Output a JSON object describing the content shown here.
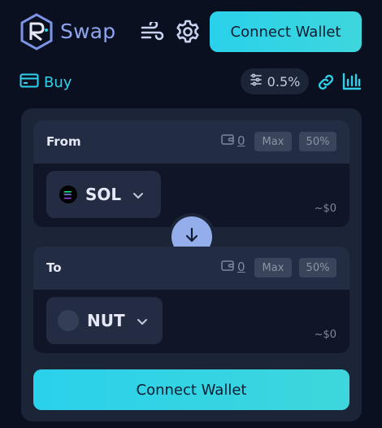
{
  "header": {
    "brand": "Swap",
    "connect_wallet": "Connect Wallet",
    "icons": [
      "logo-icon",
      "wind-icon",
      "gear-icon"
    ]
  },
  "subheader": {
    "buy_label": "Buy",
    "slippage": "0.5%",
    "icons": [
      "card-icon",
      "sliders-icon",
      "link-icon",
      "chart-icon"
    ]
  },
  "from": {
    "label": "From",
    "balance": "0",
    "max_label": "Max",
    "half_label": "50%",
    "token": "SOL",
    "usd_value": "~$0"
  },
  "to": {
    "label": "To",
    "balance": "0",
    "max_label": "Max",
    "half_label": "50%",
    "token": "NUT",
    "usd_value": "~$0"
  },
  "main": {
    "connect_wallet": "Connect Wallet"
  },
  "colors": {
    "accent": "#2ad1eb",
    "brand": "#8ea5ee",
    "background": "#0b1020",
    "card": "#1c2438"
  }
}
